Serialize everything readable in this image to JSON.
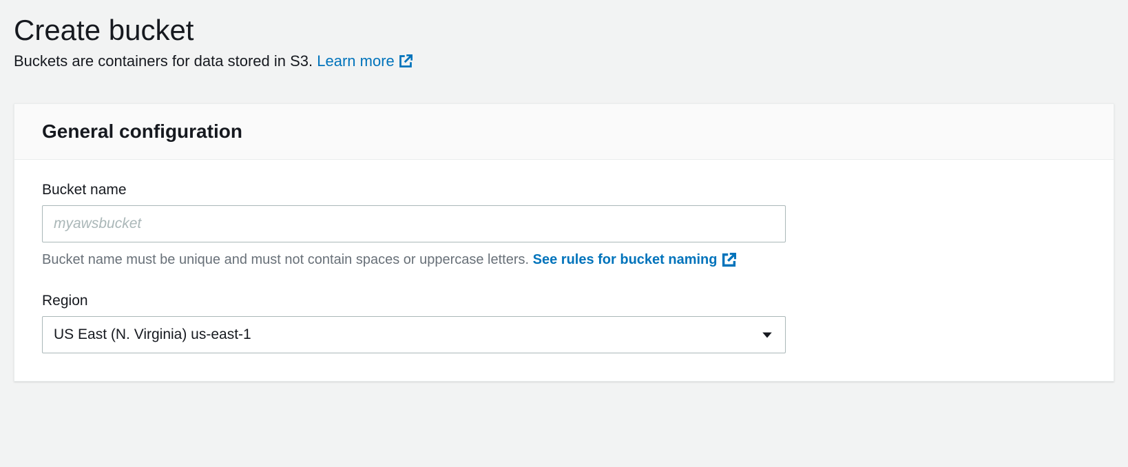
{
  "header": {
    "title": "Create bucket",
    "subtitle_prefix": "Buckets are containers for data stored in S3. ",
    "learn_more_label": "Learn more"
  },
  "panel": {
    "title": "General configuration"
  },
  "bucket_name": {
    "label": "Bucket name",
    "value": "",
    "placeholder": "myawsbucket",
    "help_text": "Bucket name must be unique and must not contain spaces or uppercase letters. ",
    "rules_link_label": "See rules for bucket naming"
  },
  "region": {
    "label": "Region",
    "selected": "US East (N. Virginia) us-east-1"
  }
}
